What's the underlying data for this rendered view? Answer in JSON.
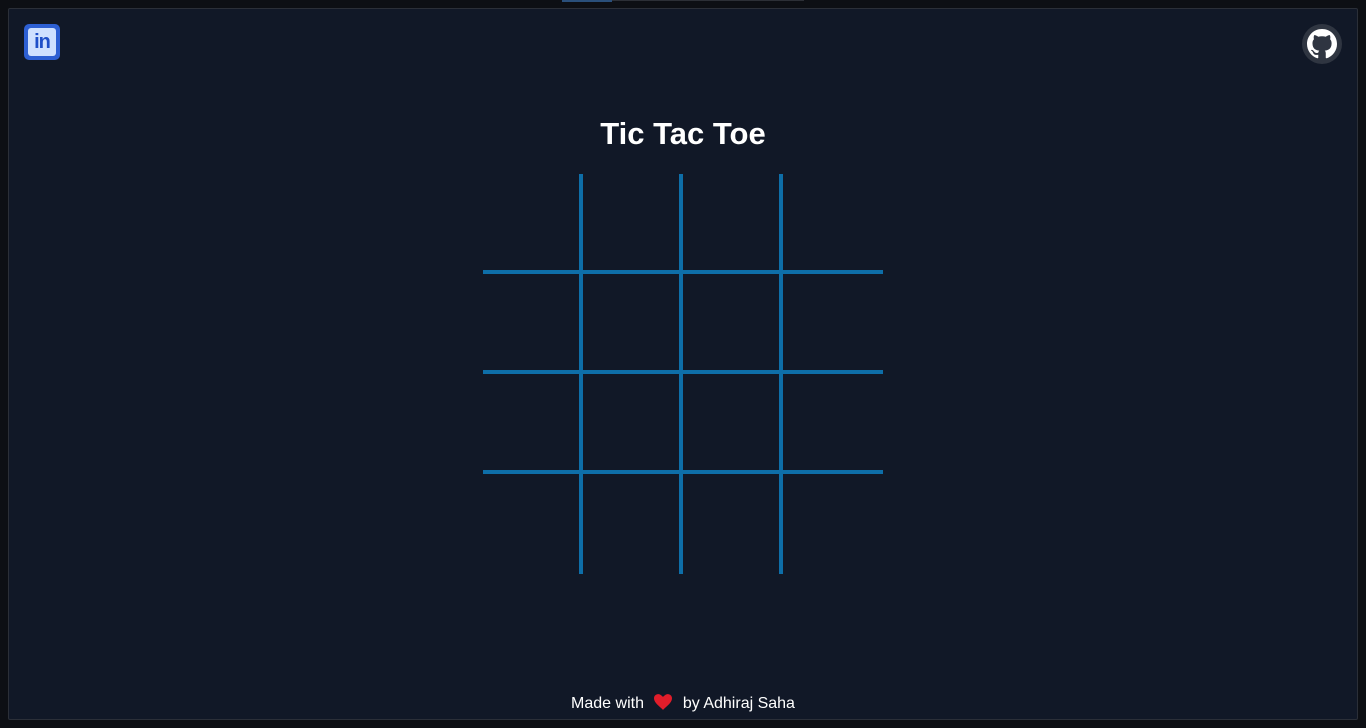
{
  "header": {
    "linkedin_icon": "linkedin-icon",
    "linkedin_text": "in",
    "github_icon": "github-icon"
  },
  "main": {
    "title": "Tic Tac Toe",
    "board": {
      "rows": 3,
      "cols": 3,
      "cells": [
        "",
        "",
        "",
        "",
        "",
        "",
        "",
        "",
        ""
      ],
      "line_color": "#0e6ea8"
    }
  },
  "footer": {
    "made_with": "Made with",
    "heart_icon": "heart-icon",
    "by_text": "by Adhiraj Saha"
  },
  "colors": {
    "background": "#111827",
    "accent": "#0e6ea8",
    "heart": "#e11d2a",
    "linkedin": "#2d5fd3"
  }
}
